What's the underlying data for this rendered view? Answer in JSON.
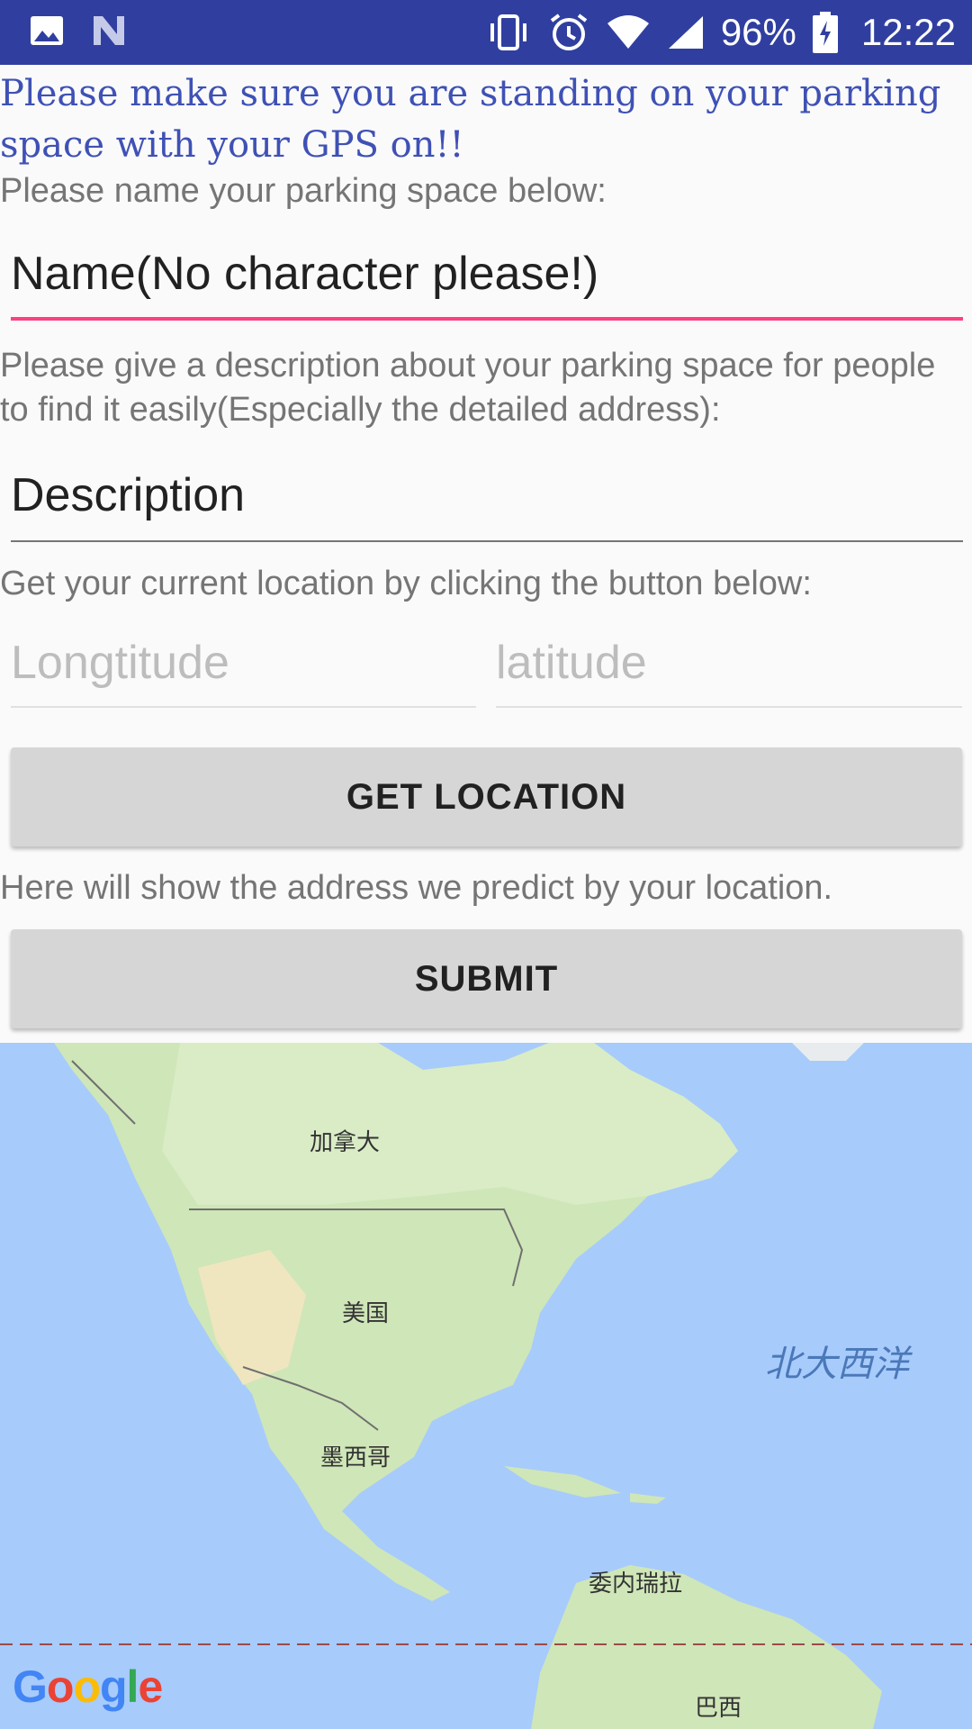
{
  "statusbar": {
    "battery": "96%",
    "time": "12:22"
  },
  "form": {
    "warning": "Please make sure you are standing on your parking space with your GPS on!!",
    "name_label": "Please name your parking space below:",
    "name_value": "Name(No character please!)",
    "desc_label": "Please give a description about your parking space for people to find it easily(Especially the detailed address):",
    "desc_value": "Description",
    "location_label": "Get your current location by clicking the button below:",
    "longitude_placeholder": "Longtitude",
    "latitude_placeholder": "latitude",
    "get_location_button": "GET LOCATION",
    "address_text": "Here will show the address we predict by your location.",
    "submit_button": "SUBMIT"
  },
  "map": {
    "labels": {
      "canada": "加拿大",
      "usa": "美国",
      "mexico": "墨西哥",
      "venezuela": "委内瑞拉",
      "brazil": "巴西",
      "atlantic": "北大西洋"
    },
    "logo": "Google"
  },
  "colors": {
    "primary_dark": "#303f9f",
    "accent": "#ff4081",
    "warning_text": "#3f51b5",
    "button": "#d6d6d6",
    "ocean": "#a7cbfb",
    "land": "#cfe6b8"
  }
}
